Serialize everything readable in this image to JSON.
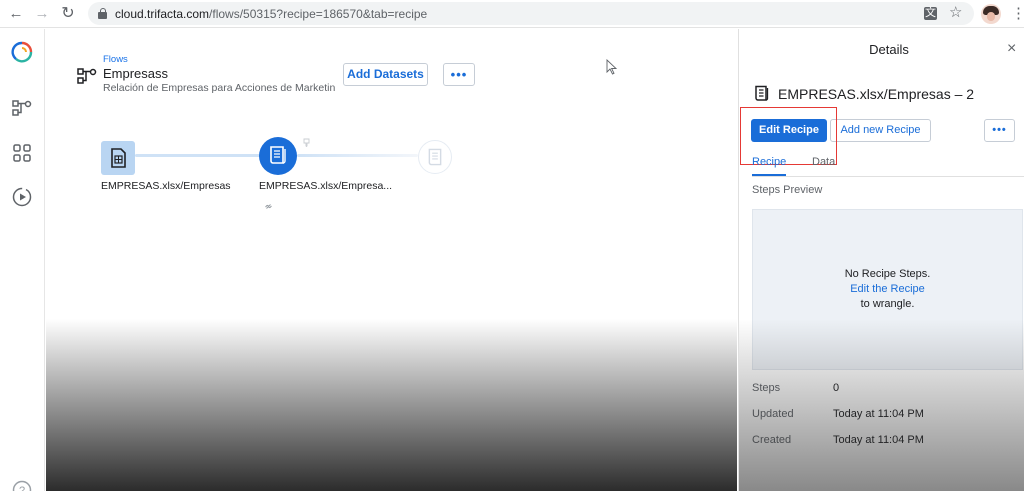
{
  "browser": {
    "url_host": "cloud.trifacta.com",
    "url_path": "/flows/50315?recipe=186570&tab=recipe",
    "back_icon": "←",
    "forward_icon": "→",
    "reload_icon": "↻",
    "star_icon": "☆",
    "menu_icon": "⋮",
    "translate_icon": "文"
  },
  "flow": {
    "breadcrumb": "Flows",
    "title": "Empresass",
    "description": "Relación de Empresas para Acciones de Marketin",
    "add_datasets_label": "Add Datasets",
    "more_label": "•••"
  },
  "nodes": {
    "dataset_label": "EMPRESAS.xlsx/Empresas",
    "recipe_label": "EMPRESAS.xlsx/Empresa..."
  },
  "details": {
    "title": "Details",
    "close_icon": "×",
    "recipe_name": "EMPRESAS.xlsx/Empresas – 2",
    "edit_recipe_label": "Edit Recipe",
    "add_new_recipe_label": "Add new Recipe",
    "more_label": "•••",
    "tabs": [
      {
        "label": "Recipe",
        "active": true
      },
      {
        "label": "Data",
        "active": false
      }
    ],
    "steps_preview_label": "Steps Preview",
    "empty_line1": "No Recipe Steps.",
    "empty_link": "Edit the Recipe",
    "empty_line3": "to wrangle.",
    "meta": {
      "steps_key": "Steps",
      "steps_val": "0",
      "updated_key": "Updated",
      "updated_val": "Today at 11:04 PM",
      "created_key": "Created",
      "created_val": "Today at 11:04 PM"
    }
  },
  "colors": {
    "accent": "#1a6dd8",
    "highlight": "#e53935",
    "dataset_node": "#b9d5f2"
  }
}
